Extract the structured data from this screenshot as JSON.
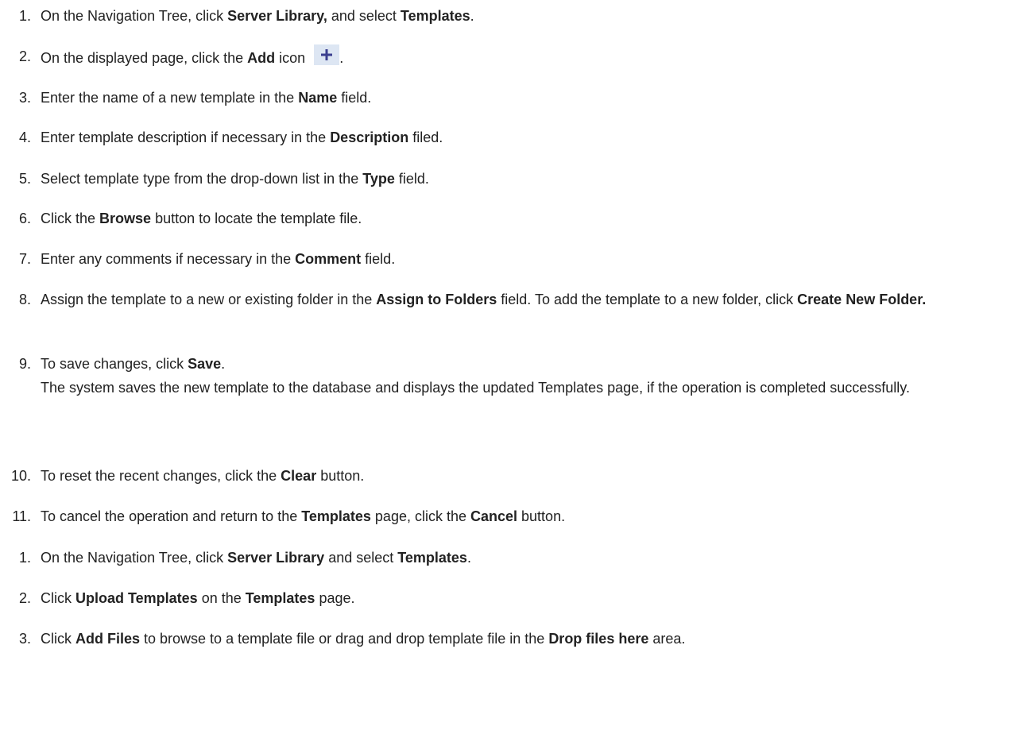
{
  "procedure_add": {
    "steps": [
      {
        "n": "1.",
        "parts": [
          "On the Navigation Tree, click ",
          "Server Library,",
          " and select ",
          "Templates",
          "."
        ]
      },
      {
        "n": "2.",
        "parts": [
          "On the displayed page, click the ",
          "Add",
          " icon ",
          "."
        ],
        "icon": "plus-icon"
      },
      {
        "n": "3.",
        "parts": [
          "Enter the name of a new template in the ",
          "Name",
          " field."
        ]
      },
      {
        "n": "4.",
        "parts": [
          "Enter template description if necessary in the ",
          "Description",
          " filed."
        ]
      },
      {
        "n": "5.",
        "parts": [
          "Select template type from the drop-down list in the ",
          "Type",
          " field."
        ]
      },
      {
        "n": "6.",
        "parts": [
          "Click the ",
          "Browse",
          " button to locate the template file."
        ]
      },
      {
        "n": "7.",
        "parts": [
          "Enter any comments if necessary in the ",
          "Comment",
          " field."
        ]
      },
      {
        "n": "8.",
        "parts": [
          "Assign the template to a new or existing folder in the ",
          "Assign to Folders",
          " field. To add the template to a new folder, click ",
          "Create New Folder."
        ]
      },
      {
        "n": "9.",
        "parts": [
          "To save changes, click ",
          "Save",
          "."
        ],
        "continuation": "The system saves the new template to the database and displays the updated Templates page, if the operation is completed successfully."
      },
      {
        "n": "10.",
        "parts": [
          "To reset the recent changes, click the ",
          "Clear",
          " button."
        ]
      },
      {
        "n": "11.",
        "parts": [
          "To cancel the operation and return to the ",
          "Templates",
          " page, click the ",
          "Cancel",
          " button."
        ]
      }
    ]
  },
  "procedure_upload": {
    "steps": [
      {
        "n": "1.",
        "parts": [
          "On the Navigation Tree, click ",
          "Server Library",
          " and select ",
          "Templates",
          "."
        ]
      },
      {
        "n": "2.",
        "parts": [
          "Click ",
          "Upload Templates",
          " on the ",
          "Templates",
          " page."
        ]
      },
      {
        "n": "3.",
        "parts": [
          "Click ",
          "Add Files",
          " to browse to a template file or drag and drop template file in the ",
          "Drop files here",
          " area."
        ]
      }
    ]
  },
  "colors": {
    "text": "#222222",
    "icon_bg": "#dde6f3",
    "icon_plus": "#3b3f8f"
  }
}
